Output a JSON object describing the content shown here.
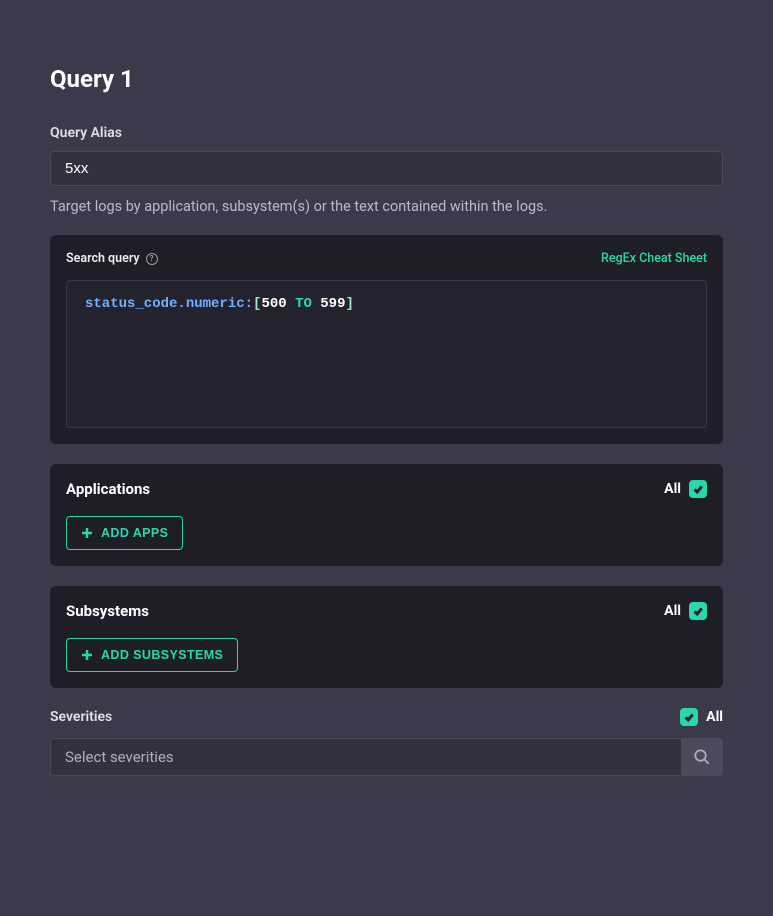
{
  "header": {
    "title": "Query 1"
  },
  "alias": {
    "label": "Query Alias",
    "value": "5xx"
  },
  "helpText": "Target logs by application, subsystem(s) or the text contained within the logs.",
  "search": {
    "label": "Search query",
    "regexLinkLabel": "RegEx Cheat Sheet",
    "tokens": {
      "field": "status_code.numeric:",
      "bracketOpen": "[",
      "num1": "500",
      "op": "TO",
      "num2": "599",
      "bracketClose": "]"
    }
  },
  "applications": {
    "title": "Applications",
    "allLabel": "All",
    "allChecked": true,
    "addLabel": "ADD APPS"
  },
  "subsystems": {
    "title": "Subsystems",
    "allLabel": "All",
    "allChecked": true,
    "addLabel": "ADD SUBSYSTEMS"
  },
  "severities": {
    "title": "Severities",
    "allLabel": "All",
    "allChecked": true,
    "placeholder": "Select severities"
  }
}
